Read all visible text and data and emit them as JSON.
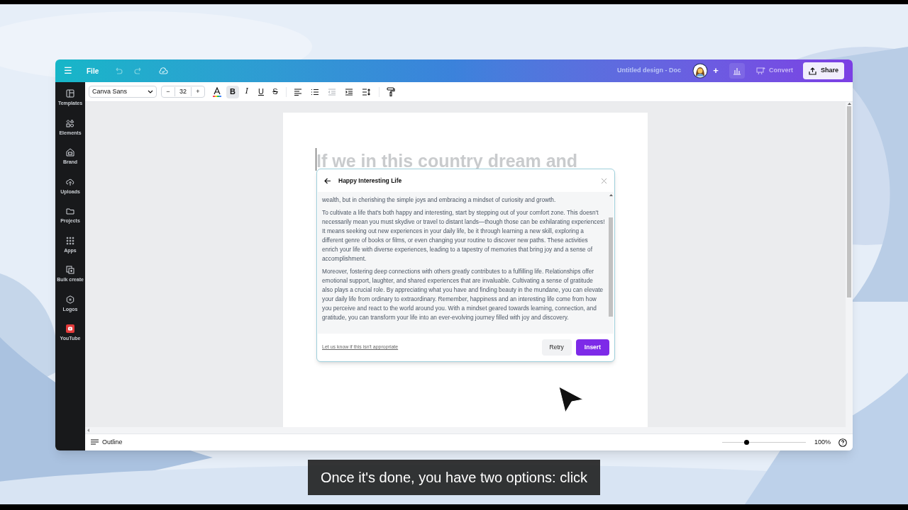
{
  "topbar": {
    "menu": "☰",
    "file": "File",
    "title": "Untitled design - Doc",
    "add": "+",
    "convert": "Convert",
    "share": "Share"
  },
  "sidebar": {
    "items": [
      {
        "label": "Templates"
      },
      {
        "label": "Elements"
      },
      {
        "label": "Brand"
      },
      {
        "label": "Uploads"
      },
      {
        "label": "Projects"
      },
      {
        "label": "Apps"
      },
      {
        "label": "Bulk create"
      },
      {
        "label": "Logos"
      },
      {
        "label": "YouTube"
      }
    ]
  },
  "toolbar": {
    "font": "Canva Sans",
    "minus": "−",
    "size": "32",
    "plus": "+",
    "styles": [
      {
        "kind": "bold",
        "label": "B",
        "selected": true
      },
      {
        "kind": "italic",
        "label": "I",
        "selected": false
      },
      {
        "kind": "underline",
        "label": "U",
        "selected": false
      },
      {
        "kind": "strike",
        "label": "S",
        "selected": false
      }
    ]
  },
  "document": {
    "heading": "If we in this country dream and"
  },
  "dialog": {
    "title": "Happy Interesting Life",
    "paragraphs": [
      "wealth, but in cherishing the simple joys and embracing a mindset of curiosity and growth.",
      "To cultivate a life that's both happy and interesting, start by stepping out of your comfort zone. This doesn't necessarily mean you must skydive or travel to distant lands—though those can be exhilarating experiences! It means seeking out new experiences in your daily life, be it through learning a new skill, exploring a different genre of books or films, or even changing your routine to discover new paths. These activities enrich your life with diverse experiences, leading to a tapestry of memories that bring joy and a sense of accomplishment.",
      "Moreover, fostering deep connections with others greatly contributes to a fulfilling life. Relationships offer emotional support, laughter, and shared experiences that are invaluable. Cultivating a sense of gratitude also plays a crucial role. By appreciating what you have and finding beauty in the mundane, you can elevate your daily life from ordinary to extraordinary. Remember, happiness and an interesting life come from how you perceive and react to the world around you. With a mindset geared towards learning, connection, and gratitude, you can transform your life into an ever-evolving journey filled with joy and discovery."
    ],
    "feedback_link": "Let us know if this isn't appropriate",
    "retry": "Retry",
    "insert": "Insert"
  },
  "bottombar": {
    "outline": "Outline",
    "zoom": {
      "level": 0.29
    },
    "zoom_label": "100%"
  },
  "caption": "Once it's done, you have two options: click"
}
